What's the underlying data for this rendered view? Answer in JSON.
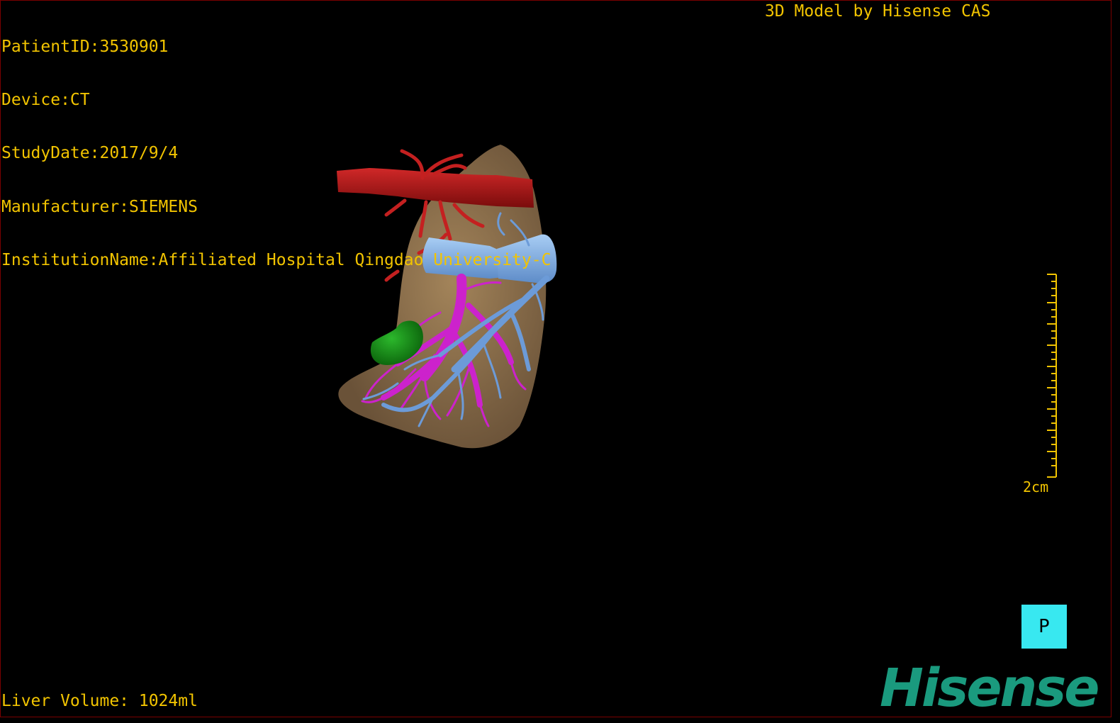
{
  "patient": {
    "patient_id": "PatientID:3530901",
    "device": "Device:CT",
    "study_date": "StudyDate:2017/9/4",
    "manufacturer": "Manufacturer:SIEMENS",
    "institution": "InstitutionName:Affiliated Hospital Qingdao University-C"
  },
  "credit": "3D Model by Hisense CAS",
  "liver_volume": "Liver Volume: 1024ml",
  "scale_bar": {
    "label": "2cm"
  },
  "orientation_marker": {
    "label": "P"
  },
  "brand_logo": "Hisense",
  "colors": {
    "overlay_text": "#f2c400",
    "liver": "#8a6c48",
    "artery": "#b01818",
    "vena_cava": "#7aa8e0",
    "portal_vein": "#cc22cc",
    "hepatic_vein": "#6c9bd8",
    "gallbladder": "#1a8c1a",
    "orientation_box": "#38e8f0",
    "logo": "#1a9a7e"
  },
  "icons": {
    "orientation": "orientation-cube-icon",
    "scale": "ruler-icon"
  }
}
